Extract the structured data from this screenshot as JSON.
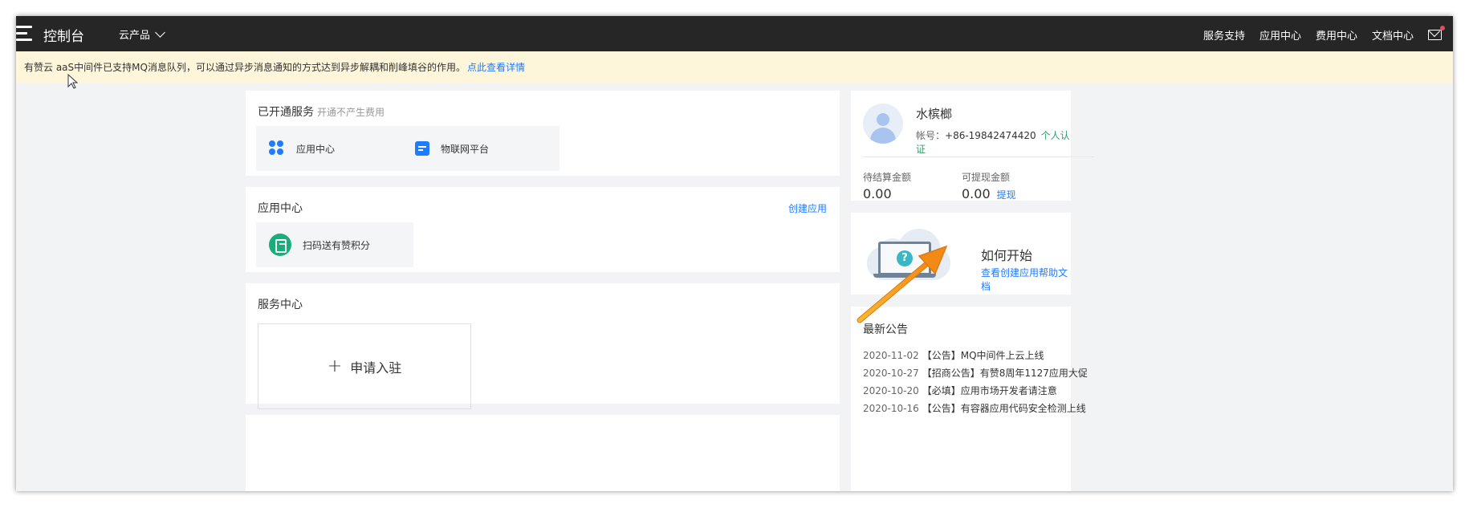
{
  "topbar": {
    "title": "控制台",
    "products_label": "云产品",
    "nav": [
      "服务支持",
      "应用中心",
      "费用中心",
      "文档中心"
    ],
    "icons": {
      "menu": "hamburger-menu-icon",
      "products": "chevron-down-icon",
      "messages": "mail-icon"
    },
    "colors": {
      "background": "#262626",
      "unread_dot": "#e34d59"
    }
  },
  "notice": {
    "text": "有赞云 aaS中间件已支持MQ消息队列，可以通过异步消息通知的方式达到异步解耦和削峰填谷的作用。",
    "link_text": "点此查看详情",
    "colors": {
      "background": "#fdf6da",
      "link": "#1f7bff"
    }
  },
  "opened_services": {
    "title": "已开通服务",
    "subtitle": "开通不产生费用",
    "tiles": [
      {
        "label": "应用中心",
        "icon": "app-grid-icon"
      },
      {
        "label": "物联网平台",
        "icon": "iot-platform-icon"
      }
    ]
  },
  "app_center": {
    "title": "应用中心",
    "create_link": "创建应用",
    "apps": [
      {
        "label": "扫码送有赞积分",
        "icon": "scan-exit-icon",
        "icon_color": "#1aad7c"
      }
    ]
  },
  "service_center": {
    "title": "服务中心",
    "apply_label": "申请入驻"
  },
  "profile": {
    "name": "水槟榔",
    "account_label": "帐号：",
    "account": "+86-19842474420",
    "verify_label": "个人认证",
    "pending_label": "待结算金额",
    "pending_value": "0.00",
    "withdrawable_label": "可提现金额",
    "withdrawable_value": "0.00",
    "withdraw_link": "提现"
  },
  "getting_started": {
    "title": "如何开始",
    "link": "查看创建应用帮助文档"
  },
  "announcements": {
    "title": "最新公告",
    "items": [
      {
        "date": "2020-11-02",
        "text": "【公告】MQ中间件上云上线"
      },
      {
        "date": "2020-10-27",
        "text": "【招商公告】有赞8周年1127应用大促"
      },
      {
        "date": "2020-10-20",
        "text": "【必填】应用市场开发者请注意"
      },
      {
        "date": "2020-10-16",
        "text": "【公告】有容器应用代码安全检测上线"
      }
    ]
  },
  "annotation": {
    "icon": "orange-arrow-icon",
    "color": "#f28a16"
  }
}
